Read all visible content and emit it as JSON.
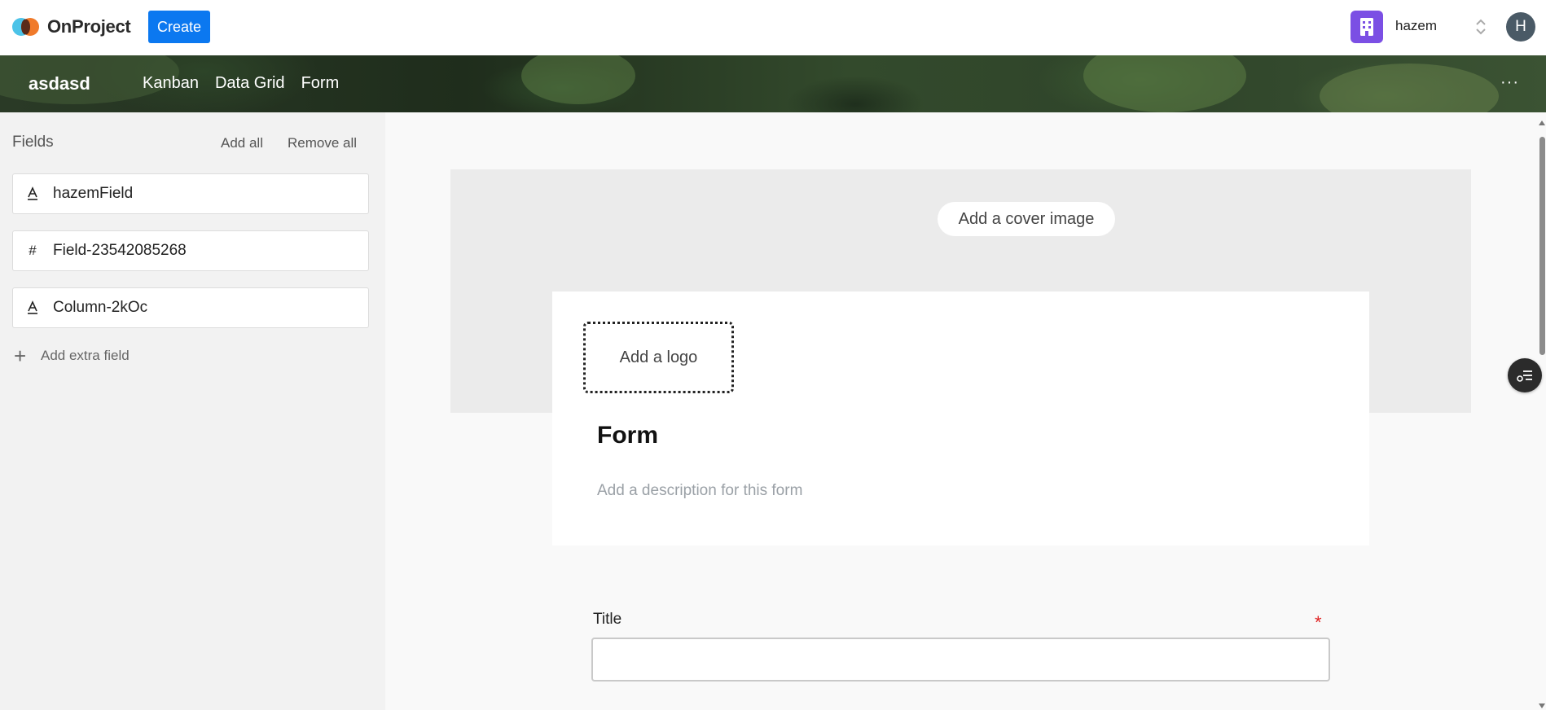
{
  "app": {
    "name": "OnProject",
    "create_label": "Create",
    "brand_color": "#0b78f0"
  },
  "workspace": {
    "name": "hazem",
    "avatar_initial": "H",
    "icon": "building-icon",
    "icon_color": "#7b4fe4"
  },
  "project": {
    "name": "asdasd",
    "views": [
      "Kanban",
      "Data Grid",
      "Form"
    ],
    "more_label": "···"
  },
  "sidebar": {
    "title": "Fields",
    "add_all_label": "Add all",
    "remove_all_label": "Remove all",
    "fields": [
      {
        "icon": "text-type-icon",
        "glyph": "A",
        "label": "hazemField"
      },
      {
        "icon": "number-type-icon",
        "glyph": "#",
        "label": "Field-23542085268"
      },
      {
        "icon": "text-type-icon",
        "glyph": "A",
        "label": "Column-2kOc"
      }
    ],
    "add_extra_label": "Add extra field"
  },
  "form": {
    "cover_label": "Add a cover image",
    "logo_label": "Add a logo",
    "title": "Form",
    "description_placeholder": "Add a description for this form",
    "questions": [
      {
        "label": "Title",
        "required": true,
        "required_mark": "*",
        "value": ""
      }
    ]
  }
}
